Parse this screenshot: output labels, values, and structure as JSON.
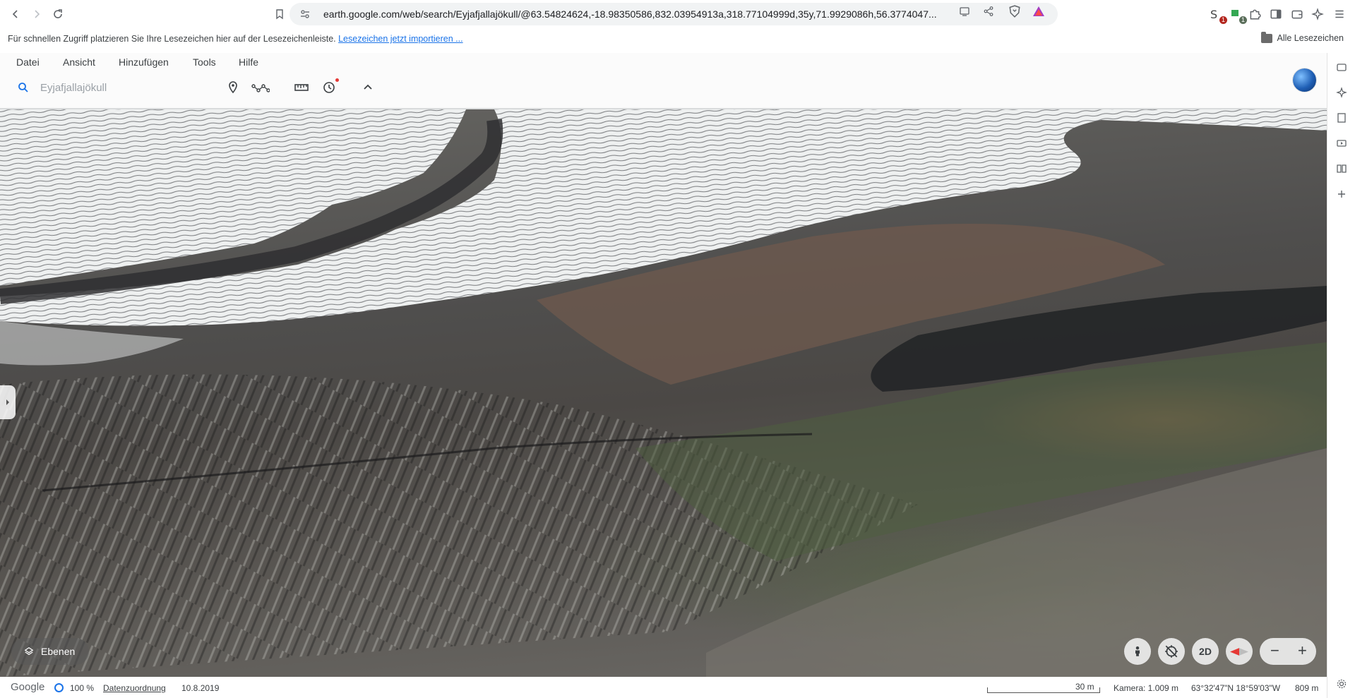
{
  "browser": {
    "url": "earth.google.com/web/search/Eyjafjallajökull/@63.54824624,-18.98350586,832.03954913a,318.77104999d,35y,71.9929086h,56.3774047...",
    "extension_badges": [
      "1",
      "1"
    ],
    "bookmarks_bar": {
      "hint_text": "Für schnellen Zugriff platzieren Sie Ihre Lesezeichen hier auf der Lesezeichenleiste.",
      "import_link": "Lesezeichen jetzt importieren ...",
      "all_bookmarks": "Alle Lesezeichen"
    }
  },
  "earth": {
    "menu": [
      "Datei",
      "Ansicht",
      "Hinzufügen",
      "Tools",
      "Hilfe"
    ],
    "search": {
      "value": "Eyjafjallajökull"
    },
    "toolbar_icons": [
      "placemark-icon",
      "path-icon",
      "measure-icon",
      "history-icon",
      "collapse-icon"
    ],
    "layers_button": "Ebenen",
    "view_mode_button": "2D",
    "zoom_out": "−",
    "zoom_in": "+",
    "status": {
      "brand": "Google",
      "load_percent": "100 %",
      "attribution_link": "Datenzuordnung",
      "imagery_date": "10.8.2019",
      "scale_label": "30 m",
      "camera": "Kamera: 1.009 m",
      "coordinates": "63°32'47\"N 18°59'03\"W",
      "elevation": "809 m"
    }
  },
  "colors": {
    "accent": "#1a73e8",
    "glacier": "#f2f4f4",
    "rock": "#4b4845",
    "moss": "#5b6b48"
  }
}
